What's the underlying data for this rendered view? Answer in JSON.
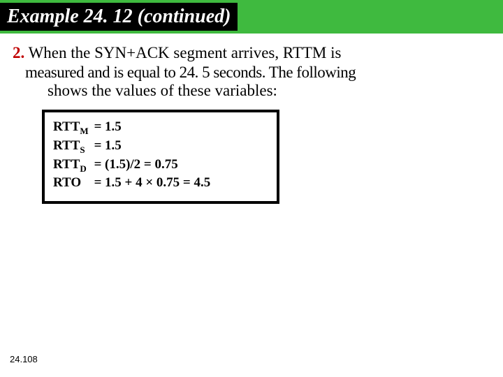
{
  "title": "Example 24. 12 (continued)",
  "item_number": "2.",
  "para_line1": "  When  the  SYN+ACK  segment  arrives,  RTTM  is",
  "para_line2": "measured and is equal to 24. 5 seconds. The following",
  "para_line3": "shows the values of these variables:",
  "equations": [
    {
      "var": "RTT",
      "sub": "M",
      "expr": "1.5"
    },
    {
      "var": "RTT",
      "sub": "S",
      "expr": "1.5"
    },
    {
      "var": "RTT",
      "sub": "D",
      "expr": "(1.5)/2 = 0.75"
    },
    {
      "var": "RTO",
      "sub": "",
      "expr": "1.5 + 4 × 0.75 = 4.5"
    }
  ],
  "page_number": "24.108"
}
